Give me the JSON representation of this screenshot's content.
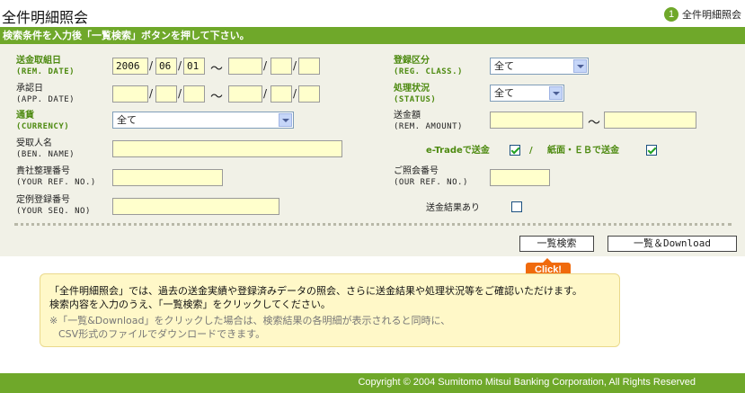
{
  "page_title": "全件明細照会",
  "step": {
    "number": "1",
    "label": "全件明細照会"
  },
  "instruction": "検索条件を入力後「一覧検索」ボタンを押して下さい。",
  "fields": {
    "rem_date": {
      "label": "送金取組日",
      "sub": "(REM. DATE)",
      "from_y": "2006",
      "from_m": "06",
      "from_d": "01",
      "to_y": "",
      "to_m": "",
      "to_d": ""
    },
    "app_date": {
      "label": "承認日",
      "sub": "(APP. DATE)"
    },
    "currency": {
      "label": "通貨",
      "sub": "(CURRENCY)",
      "value": "全て"
    },
    "ben_name": {
      "label": "受取人名",
      "sub": "(BEN. NAME)",
      "value": ""
    },
    "your_ref": {
      "label": "貴社整理番号",
      "sub": "(YOUR REF. NO.)",
      "value": ""
    },
    "your_seq": {
      "label": "定例登録番号",
      "sub": "(YOUR SEQ. NO)",
      "value": ""
    },
    "reg_class": {
      "label": "登録区分",
      "sub": "(REG. CLASS.)",
      "value": "全て"
    },
    "status": {
      "label": "処理状況",
      "sub": "(STATUS)",
      "value": "全て"
    },
    "rem_amount": {
      "label": "送金額",
      "sub": "(REM. AMOUNT)"
    },
    "etrade_label": "e-Tradeで送金",
    "separator": "/",
    "paper_label": "紙面・ＥＢで送金",
    "our_ref": {
      "label": "ご照会番号",
      "sub": "(OUR REF. NO.)",
      "value": ""
    },
    "result_label": "送金結果あり",
    "slash": "/",
    "tilde": "～"
  },
  "buttons": {
    "search": "一覧検索",
    "download": "一覧＆Download"
  },
  "click_badge": "Click!",
  "info": {
    "line1": "「全件明細照会」では、過去の送金実績や登録済みデータの照会、さらに送金結果や処理状況等をご確認いただけます。",
    "line2": "検索内容を入力のうえ、「一覧検索」をクリックしてください。",
    "line3": "※「一覧&Download」をクリックした場合は、検索結果の各明細が表示されると同時に、",
    "line4": "CSV形式のファイルでダウンロードできます。"
  },
  "footer": "Copyright © 2004 Sumitomo Mitsui Banking Corporation, All Rights Reserved",
  "colors": {
    "brand_green": "#6fa82a",
    "input_bg": "#ffffcc",
    "click_orange": "#f06a0c"
  }
}
